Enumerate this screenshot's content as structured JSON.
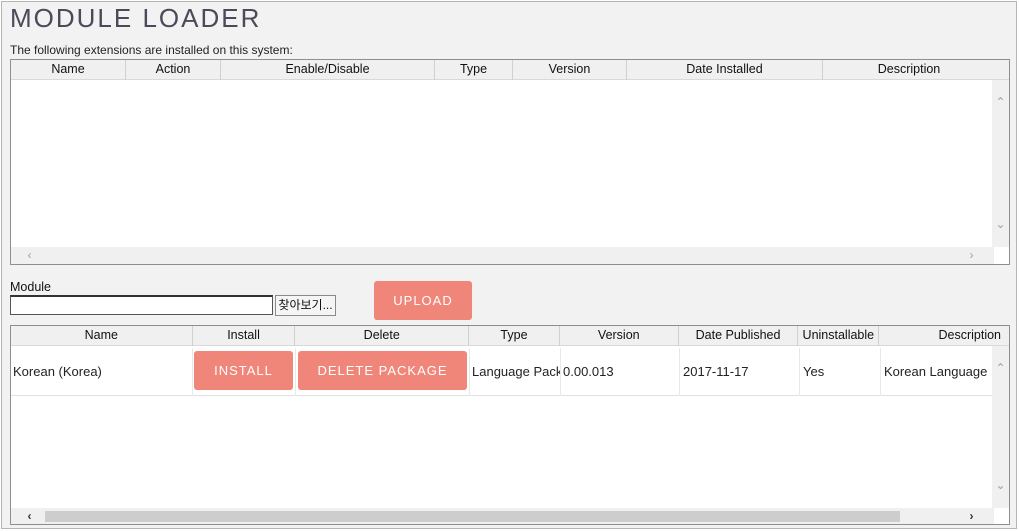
{
  "header": {
    "title": "MODULE LOADER",
    "installed_caption": "The following extensions are installed on this system:"
  },
  "installed_table": {
    "columns": [
      "Name",
      "Action",
      "Enable/Disable",
      "Type",
      "Version",
      "Date Installed",
      "Description"
    ],
    "rows": []
  },
  "upload": {
    "module_label": "Module",
    "file_value": "",
    "browse_label": "찾아보기...",
    "upload_label": "UPLOAD"
  },
  "packages_table": {
    "columns": [
      "Name",
      "Install",
      "Delete",
      "Type",
      "Version",
      "Date Published",
      "Uninstallable",
      "Description"
    ],
    "rows": [
      {
        "name": "Korean (Korea)",
        "install_label": "INSTALL",
        "delete_label": "DELETE PACKAGE",
        "type": "Language Pack",
        "version": "0.00.013",
        "date_published": "2017-11-17",
        "uninstallable": "Yes",
        "description": "Korean Language P"
      }
    ]
  },
  "colors": {
    "accent": "#f0867a",
    "panel_bg": "#f2f2f2",
    "title_color": "#4a4a5a"
  },
  "icons": {
    "scroll_up": "chevron-up-icon",
    "scroll_down": "chevron-down-icon",
    "scroll_left": "chevron-left-icon",
    "scroll_right": "chevron-right-icon"
  }
}
